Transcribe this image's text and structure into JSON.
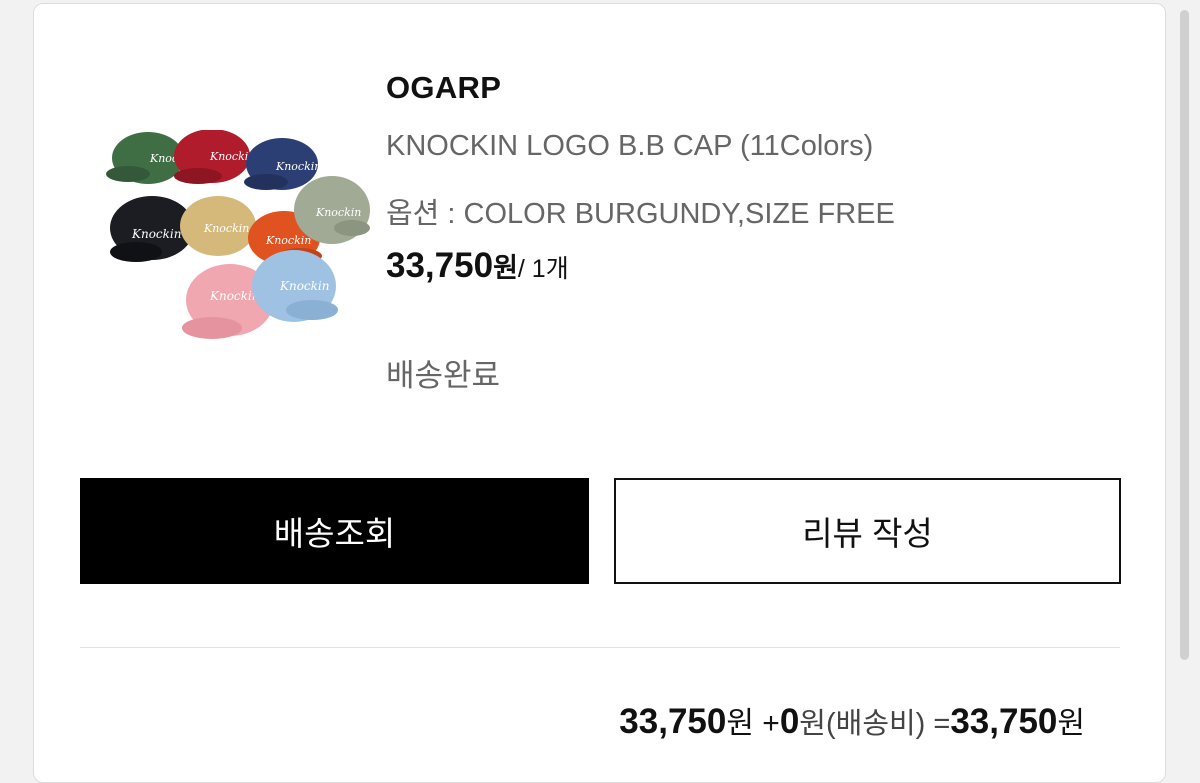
{
  "product": {
    "brand": "OGARP",
    "name": "KNOCKIN LOGO B.B CAP (11Colors)",
    "option": "옵션 : COLOR BURGUNDY,SIZE FREE",
    "price_amount": "33,750",
    "price_currency": "원",
    "price_qty": "/ 1개",
    "status": "배송완료",
    "image_text": "Knockin"
  },
  "buttons": {
    "track_label": "배송조회",
    "review_label": "리뷰 작성"
  },
  "summary": {
    "item_amount": "33,750",
    "item_currency": "원",
    "shipping_prefix": " +",
    "shipping_amount": "0",
    "shipping_label": "원(배송비) =",
    "total_amount": "33,750",
    "total_currency": "원"
  },
  "colors": {
    "cap_green": "#3f6e45",
    "cap_red": "#b01c2b",
    "cap_navy": "#2c3f74",
    "cap_black": "#1b1d22",
    "cap_beige": "#d4b97a",
    "cap_orange": "#e0521f",
    "cap_sage": "#a1aa95",
    "cap_pink": "#f1a7b0",
    "cap_skyblue": "#9fc2e3"
  }
}
